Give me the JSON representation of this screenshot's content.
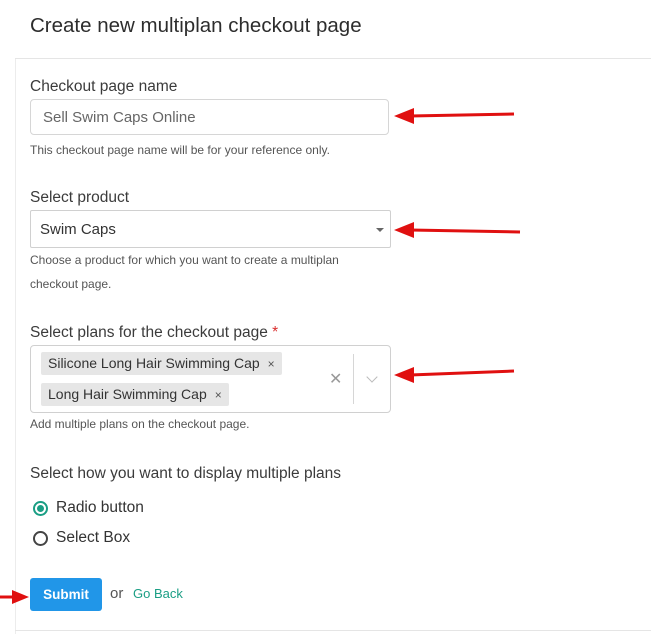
{
  "header": {
    "title": "Create new multiplan checkout page"
  },
  "checkout_name": {
    "label": "Checkout page name",
    "value": "Sell Swim Caps Online",
    "help": "This checkout page name will be for your reference only."
  },
  "product": {
    "label": "Select product",
    "selected": "Swim Caps",
    "help_line1": "Choose a product for which you want to create a multiplan",
    "help_line2": "checkout page."
  },
  "plans": {
    "label": "Select plans for the checkout page",
    "required_mark": "*",
    "chips": [
      "Silicone Long Hair Swimming Cap",
      "Long Hair Swimming Cap"
    ],
    "chip_remove": "×",
    "clear_glyph": "✕",
    "help": "Add multiple plans on the checkout page."
  },
  "display": {
    "label": "Select how you want to display multiple plans",
    "options": [
      "Radio button",
      "Select Box"
    ],
    "selected_index": 0
  },
  "actions": {
    "submit": "Submit",
    "or": "or",
    "go_back": "Go Back"
  },
  "colors": {
    "accent_teal": "#1a9e84",
    "button_blue": "#2196e8",
    "arrow_red": "#e01010",
    "required_red": "#d92d2d"
  }
}
